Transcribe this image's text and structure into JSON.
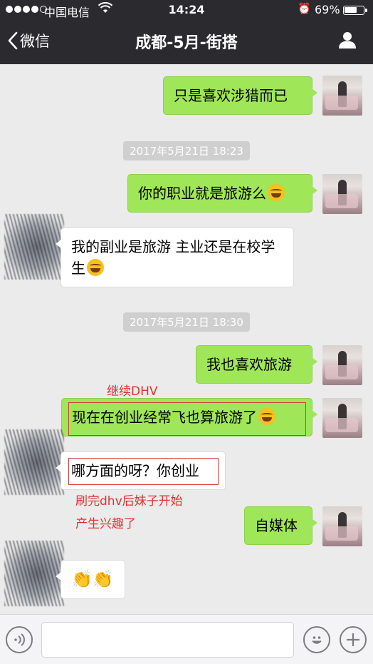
{
  "status": {
    "carrier": "中国电信",
    "time": "14:24",
    "battery_pct": "69%",
    "battery_level": 0.69,
    "signal_bars_filled": 4
  },
  "nav": {
    "back_label": "微信",
    "title": "成都-5月-街搭",
    "back_icon": "chevron-left-icon",
    "profile_icon": "person-icon"
  },
  "messages": [
    {
      "from": "me",
      "text": "只是喜欢涉猎而已"
    },
    {
      "timestamp": "2017年5月21日 18:23"
    },
    {
      "from": "me",
      "text": "你的职业就是旅游么",
      "emoji": "laugh-cry-emoji"
    },
    {
      "from": "other",
      "text": "我的副业是旅游 主业还是在校学生",
      "emoji": "laugh-cry-emoji"
    },
    {
      "timestamp": "2017年5月21日 18:30"
    },
    {
      "from": "me",
      "text": "我也喜欢旅游"
    },
    {
      "from": "me",
      "text": "现在在创业经常飞也算旅游了",
      "emoji": "laugh-cry-emoji"
    },
    {
      "from": "other",
      "text": "哪方面的呀？你创业"
    },
    {
      "from": "me",
      "text": "自媒体"
    },
    {
      "from": "other",
      "text": "👏👏"
    }
  ],
  "annotations": {
    "dhv": "继续DHV",
    "after_line1": "刷完dhv后妹子开始",
    "after_line2": "产生兴趣了"
  },
  "colors": {
    "my_bubble": "#9fe658",
    "other_bubble": "#ffffff",
    "annotation": "#e03232",
    "nav_bg": "#2b2b2f"
  },
  "input_bar": {
    "voice_icon": "voice-icon",
    "emoji_icon": "smiley-icon",
    "add_icon": "plus-icon",
    "value": ""
  }
}
